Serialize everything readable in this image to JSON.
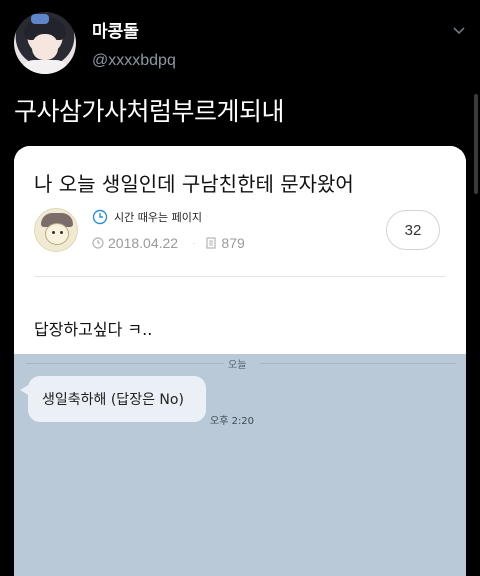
{
  "user": {
    "display_name": "마콩돌",
    "handle": "@xxxxbdpq"
  },
  "tweet": {
    "text": "구사삼가사처럼부르게되내"
  },
  "media": {
    "post": {
      "title": "나 오늘 생일인데 구남친한테 문자왔어",
      "page_name": "시간 때우는 페이지",
      "date": "2018.04.22",
      "views": "879",
      "comment_count": "32",
      "body": "답장하고싶다 ㅋ.."
    },
    "chat": {
      "date_divider": "오늘",
      "message": "생일축하해 (답장은 No)",
      "time": "오후 2:20"
    }
  }
}
